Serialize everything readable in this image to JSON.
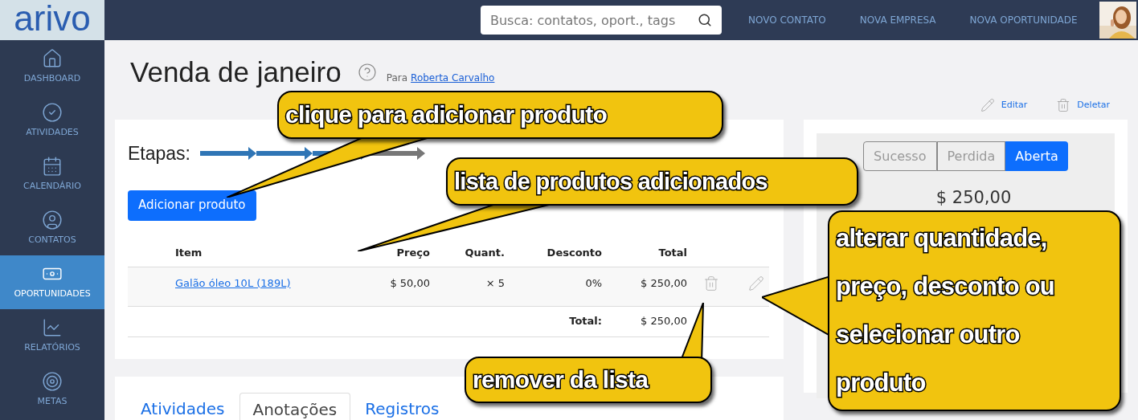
{
  "logo": {
    "text": "arivo"
  },
  "sidebar": {
    "items": [
      {
        "label": "DASHBOARD",
        "kind": "home",
        "selected": false
      },
      {
        "label": "ATIVIDADES",
        "kind": "check",
        "selected": false
      },
      {
        "label": "CALENDÁRIO",
        "kind": "calendar",
        "selected": false
      },
      {
        "label": "CONTATOS",
        "kind": "contact",
        "selected": false
      },
      {
        "label": "OPORTUNIDADES",
        "kind": "money",
        "selected": true
      },
      {
        "label": "RELATÓRIOS",
        "kind": "chart",
        "selected": false
      },
      {
        "label": "METAS",
        "kind": "target",
        "selected": false
      }
    ]
  },
  "search": {
    "placeholder": "Busca: contatos, oport., tags"
  },
  "top_links": [
    "NOVO CONTATO",
    "NOVA EMPRESA",
    "NOVA OPORTUNIDADE"
  ],
  "page": {
    "title": "Venda de janeiro",
    "for_label": "Para",
    "contact": "Roberta Carvalho"
  },
  "actions": [
    {
      "label": "Editar",
      "kind": "edit"
    },
    {
      "label": "Deletar",
      "kind": "delete"
    }
  ],
  "stages": {
    "label": "Etapas:",
    "steps": [
      {
        "done": true
      },
      {
        "done": true
      },
      {
        "done": true
      },
      {
        "done": false
      }
    ]
  },
  "add_button": "Adicionar produto",
  "products": {
    "columns": [
      "Item",
      "Preço",
      "Quant.",
      "Desconto",
      "Total"
    ],
    "rows": [
      {
        "item": "Galão óleo 10L (189L)",
        "price": "$ 50,00",
        "quantity": "× 5",
        "discount": "0%",
        "total": "$ 250,00"
      }
    ],
    "footer_label": "Total:",
    "footer_value": "$ 250,00"
  },
  "status": {
    "options": [
      {
        "label": "Sucesso",
        "selected": false
      },
      {
        "label": "Perdida",
        "selected": false
      },
      {
        "label": "Aberta",
        "selected": true
      }
    ],
    "amount": "$ 250,00"
  },
  "tabs": [
    {
      "label": "Atividades",
      "selected": false
    },
    {
      "label": "Anotações",
      "selected": true
    },
    {
      "label": "Registros",
      "selected": false
    }
  ],
  "callouts": [
    {
      "text": "clique para adicionar produto"
    },
    {
      "text": "lista de produtos adicionados"
    },
    {
      "text": "remover da lista"
    },
    {
      "text": "alterar quantidade, preço, desconto ou selecionar outro produto"
    }
  ]
}
